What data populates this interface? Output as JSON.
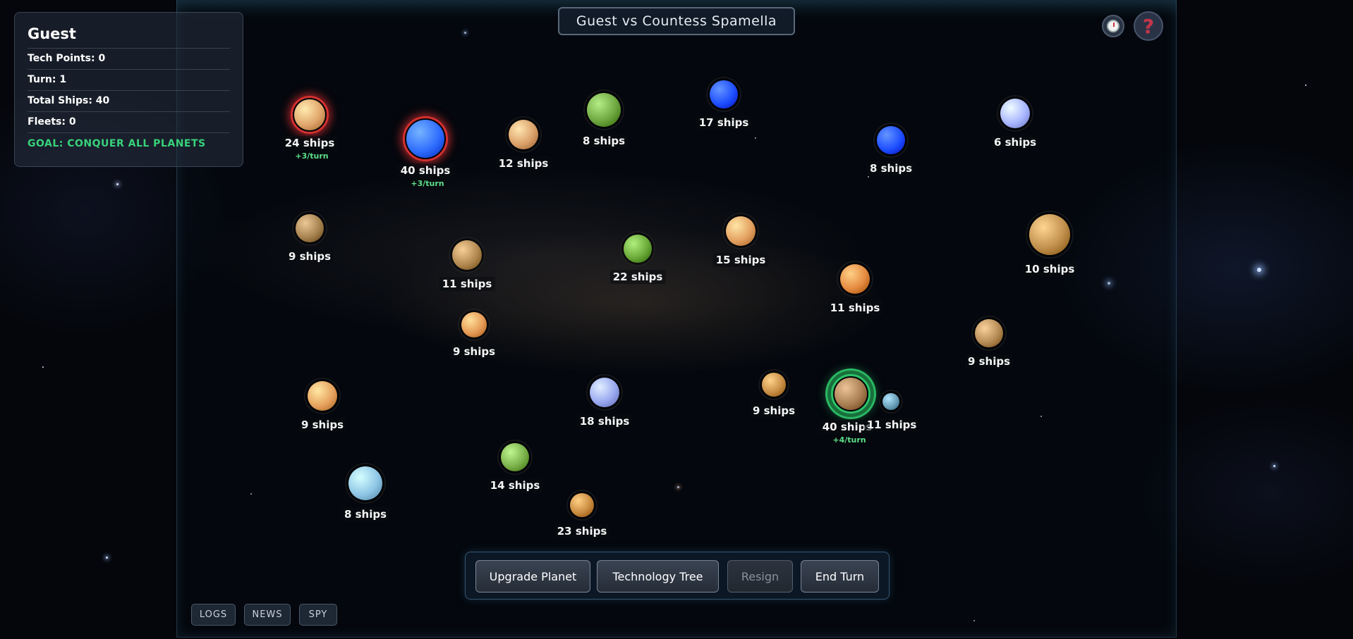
{
  "title": "Guest vs Countess Spamella",
  "player": {
    "name": "Guest",
    "tech_points": "Tech Points: 0",
    "turn": "Turn: 1",
    "total_ships": "Total Ships: 40",
    "fleets": "Fleets: 0",
    "goal": "GOAL: CONQUER ALL PLANETS"
  },
  "icons": {
    "clock": "clock-icon",
    "help": "question-mark-icon",
    "help_glyph": "?"
  },
  "planets": [
    {
      "ships": "24 ships",
      "production": "+3/turn",
      "owner": "enemy",
      "color": "#e0a56a"
    },
    {
      "ships": "40 ships",
      "production": "+3/turn",
      "owner": "enemy",
      "color": "#2f6dff"
    },
    {
      "ships": "12 ships",
      "color": "#dba06a"
    },
    {
      "ships": "8 ships",
      "color": "#6ea640"
    },
    {
      "ships": "17 ships",
      "color": "#1e4fff"
    },
    {
      "ships": "8 ships",
      "color": "#1e4fff"
    },
    {
      "ships": "6 ships",
      "color": "#a9b6ff"
    },
    {
      "ships": "9 ships",
      "color": "#a5824f"
    },
    {
      "ships": "11 ships",
      "color": "#b08850"
    },
    {
      "ships": "22 ships",
      "color": "#6aa838"
    },
    {
      "ships": "15 ships",
      "color": "#e3a060"
    },
    {
      "ships": "10 ships",
      "color": "#c08f4c"
    },
    {
      "ships": "11 ships",
      "color": "#e38a40"
    },
    {
      "ships": "9 ships",
      "color": "#e59a55"
    },
    {
      "ships": "9 ships",
      "color": "#b48a55"
    },
    {
      "ships": "9 ships",
      "color": "#e6a25e"
    },
    {
      "ships": "18 ships",
      "color": "#9aa8f0"
    },
    {
      "ships": "9 ships",
      "color": "#c88d45"
    },
    {
      "ships": "40 ships",
      "production": "+4/turn",
      "owner": "player",
      "color": "#a77e52"
    },
    {
      "ships": "11 ships",
      "color": "#6a9fb8"
    },
    {
      "ships": "14 ships",
      "color": "#7ab04a"
    },
    {
      "ships": "8 ships",
      "color": "#8fc6e6"
    },
    {
      "ships": "23 ships",
      "color": "#c98a3e"
    }
  ],
  "actions": {
    "upgrade": "Upgrade Planet",
    "tech_tree": "Technology Tree",
    "resign": "Resign",
    "end_turn": "End Turn"
  },
  "bottom": {
    "logs": "LOGS",
    "news": "NEWS",
    "spy": "SPY"
  },
  "colors": {
    "goal": "#38d27a",
    "production": "#5ee08a",
    "enemy_ring": "#e03434",
    "player_ring": "#2fcf6f"
  }
}
